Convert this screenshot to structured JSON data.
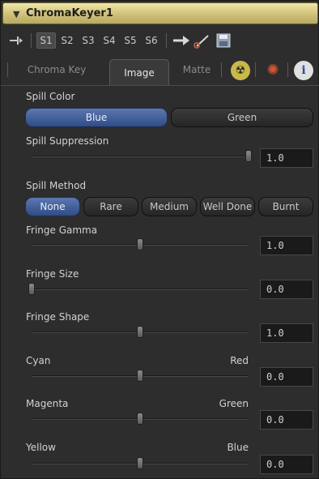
{
  "header": {
    "title": "ChromaKeyer1"
  },
  "toolbar": {
    "scene_buttons": [
      "S1",
      "S2",
      "S3",
      "S4",
      "S5",
      "S6"
    ],
    "selected_scene": "S1"
  },
  "tabs": [
    {
      "label": "Chroma Key",
      "active": false
    },
    {
      "label": "Image",
      "active": true
    },
    {
      "label": "Matte",
      "active": false
    }
  ],
  "tab_icons": [
    "radioactive-icon",
    "gear-icon",
    "info-icon"
  ],
  "spill_color": {
    "label": "Spill Color",
    "options": [
      "Blue",
      "Green"
    ],
    "selected": "Blue"
  },
  "spill_suppression": {
    "label": "Spill Suppression",
    "value": "1.0",
    "fraction": 1.0
  },
  "spill_method": {
    "label": "Spill Method",
    "options": [
      "None",
      "Rare",
      "Medium",
      "Well Done",
      "Burnt"
    ],
    "selected": "None"
  },
  "fringe_gamma": {
    "label": "Fringe Gamma",
    "value": "1.0",
    "fraction": 0.5
  },
  "fringe_size": {
    "label": "Fringe Size",
    "value": "0.0",
    "fraction": 0.0
  },
  "fringe_shape": {
    "label": "Fringe Shape",
    "value": "1.0",
    "fraction": 0.5
  },
  "cyan_red": {
    "left_label": "Cyan",
    "right_label": "Red",
    "value": "0.0",
    "fraction": 0.5
  },
  "magenta_green": {
    "left_label": "Magenta",
    "right_label": "Green",
    "value": "0.0",
    "fraction": 0.5
  },
  "yellow_blue": {
    "left_label": "Yellow",
    "right_label": "Blue",
    "value": "0.0",
    "fraction": 0.5
  },
  "colors": {
    "header": "#d8c985",
    "accent": "#3f5d9a",
    "panel": "#2d2d2d"
  }
}
